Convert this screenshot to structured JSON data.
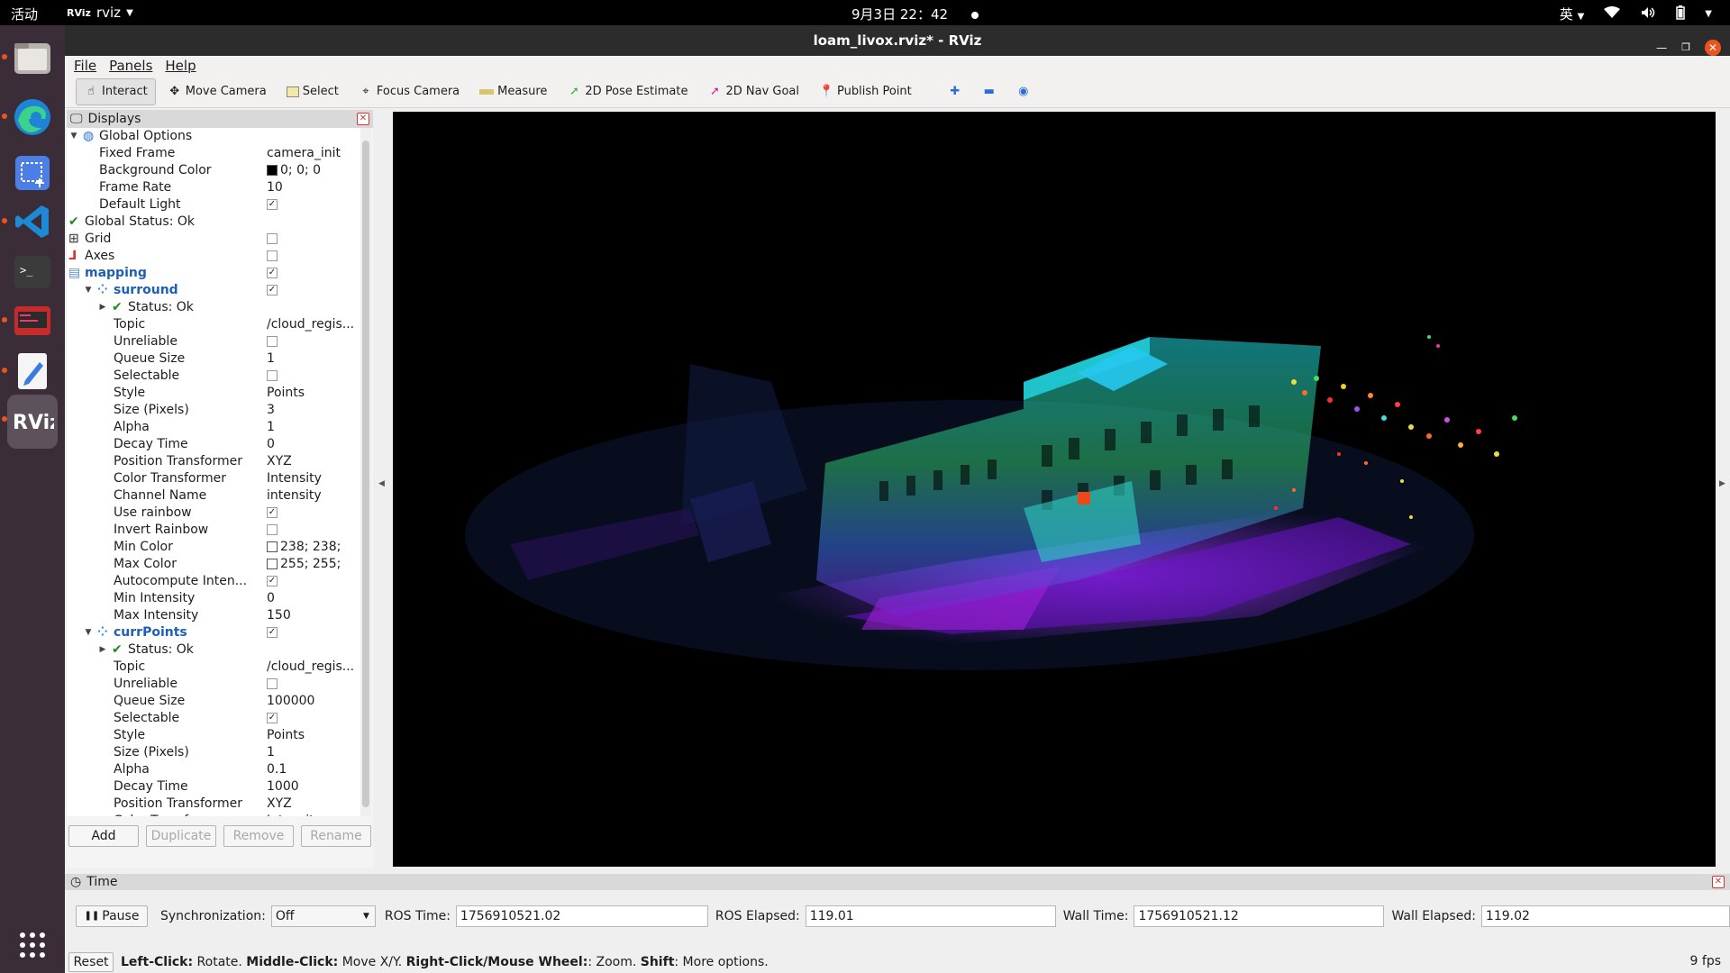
{
  "topbar": {
    "activities": "活动",
    "app_logo": "RViz",
    "app_name": "rviz",
    "clock": "9月3日  22：42",
    "input_method": "英"
  },
  "window": {
    "title": "loam_livox.rviz* - RViz"
  },
  "menu": {
    "file": "File",
    "panels": "Panels",
    "help": "Help"
  },
  "toolbar": {
    "interact": "Interact",
    "move_camera": "Move Camera",
    "select": "Select",
    "focus_camera": "Focus Camera",
    "measure": "Measure",
    "pose_estimate": "2D Pose Estimate",
    "nav_goal": "2D Nav Goal",
    "publish_point": "Publish Point"
  },
  "displays_panel": {
    "title": "Displays",
    "rows": [
      {
        "label": "Global Options",
        "value": ""
      },
      {
        "label": "Fixed Frame",
        "value": "camera_init"
      },
      {
        "label": "Background Color",
        "value": "0; 0; 0"
      },
      {
        "label": "Frame Rate",
        "value": "10"
      },
      {
        "label": "Default Light",
        "value": ""
      },
      {
        "label": "Global Status: Ok",
        "value": ""
      },
      {
        "label": "Grid",
        "value": ""
      },
      {
        "label": "Axes",
        "value": ""
      },
      {
        "label": "mapping",
        "value": ""
      },
      {
        "label": "surround",
        "value": ""
      },
      {
        "label": "Status: Ok",
        "value": ""
      },
      {
        "label": "Topic",
        "value": "/cloud_regis..."
      },
      {
        "label": "Unreliable",
        "value": ""
      },
      {
        "label": "Queue Size",
        "value": "1"
      },
      {
        "label": "Selectable",
        "value": ""
      },
      {
        "label": "Style",
        "value": "Points"
      },
      {
        "label": "Size (Pixels)",
        "value": "3"
      },
      {
        "label": "Alpha",
        "value": "1"
      },
      {
        "label": "Decay Time",
        "value": "0"
      },
      {
        "label": "Position Transformer",
        "value": "XYZ"
      },
      {
        "label": "Color Transformer",
        "value": "Intensity"
      },
      {
        "label": "Channel Name",
        "value": "intensity"
      },
      {
        "label": "Use rainbow",
        "value": ""
      },
      {
        "label": "Invert Rainbow",
        "value": ""
      },
      {
        "label": "Min Color",
        "value": "238; 238;"
      },
      {
        "label": "Max Color",
        "value": "255; 255;"
      },
      {
        "label": "Autocompute Inten...",
        "value": ""
      },
      {
        "label": "Min Intensity",
        "value": "0"
      },
      {
        "label": "Max Intensity",
        "value": "150"
      },
      {
        "label": "currPoints",
        "value": ""
      },
      {
        "label": "Status: Ok",
        "value": ""
      },
      {
        "label": "Topic",
        "value": "/cloud_regis..."
      },
      {
        "label": "Unreliable",
        "value": ""
      },
      {
        "label": "Queue Size",
        "value": "100000"
      },
      {
        "label": "Selectable",
        "value": ""
      },
      {
        "label": "Style",
        "value": "Points"
      },
      {
        "label": "Size (Pixels)",
        "value": "1"
      },
      {
        "label": "Alpha",
        "value": "0.1"
      },
      {
        "label": "Decay Time",
        "value": "1000"
      },
      {
        "label": "Position Transformer",
        "value": "XYZ"
      },
      {
        "label": "Color Transformer",
        "value": "Intensity"
      }
    ],
    "buttons": {
      "add": "Add",
      "duplicate": "Duplicate",
      "remove": "Remove",
      "rename": "Rename"
    }
  },
  "time_panel": {
    "title": "Time",
    "pause": "Pause",
    "sync_label": "Synchronization:",
    "sync_value": "Off",
    "ros_time_label": "ROS Time:",
    "ros_time": "1756910521.02",
    "ros_elapsed_label": "ROS Elapsed:",
    "ros_elapsed": "119.01",
    "wall_time_label": "Wall Time:",
    "wall_time": "1756910521.12",
    "wall_elapsed_label": "Wall Elapsed:",
    "wall_elapsed": "119.02"
  },
  "statusbar": {
    "reset": "Reset",
    "k1": "Left-Click:",
    "t1": " Rotate. ",
    "k2": "Middle-Click:",
    "t2": " Move X/Y. ",
    "k3": "Right-Click/Mouse Wheel:",
    "t3": ": Zoom. ",
    "k4": "Shift",
    "t4": ": More options.",
    "fps": "9 fps"
  },
  "colors": {
    "accent": "#e95420",
    "dock": "#3a2d38",
    "link_blue": "#1f5fb5"
  }
}
